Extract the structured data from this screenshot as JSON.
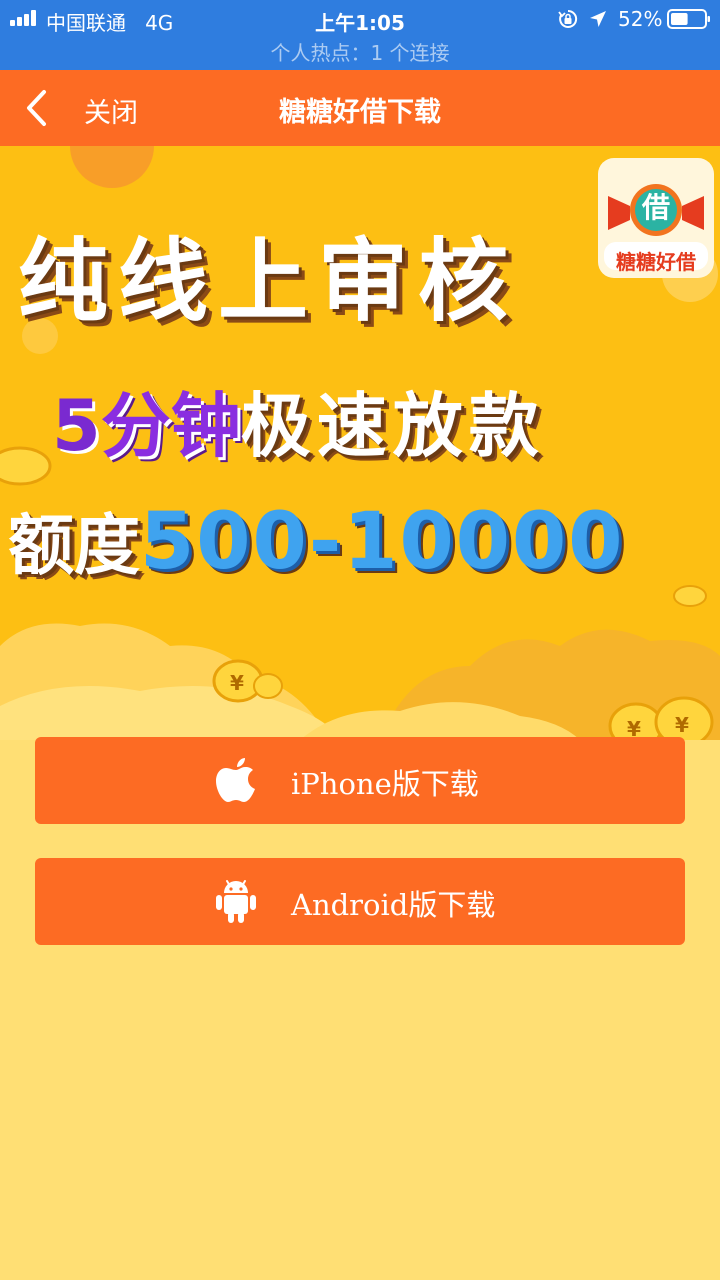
{
  "status_bar": {
    "carrier": "中国联通",
    "network": "4G",
    "time": "上午1:05",
    "battery_percent": "52%",
    "battery_level": 0.52,
    "hotspot": "个人热点：1 个连接"
  },
  "nav": {
    "close_label": "关闭",
    "title": "糖糖好借下载"
  },
  "banner": {
    "logo_char": "借",
    "logo_name": "糖糖好借",
    "headline": "纯线上审核",
    "speed_number": "5",
    "speed_unit": "分钟",
    "speed_text": "极速放款",
    "quota_label": "额度",
    "quota_range": "500-10000"
  },
  "downloads": {
    "iphone_label": "iPhone版下载",
    "android_label": "Android版下载"
  },
  "colors": {
    "status_bar": "#2f7ddf",
    "nav_bar": "#fd6b23",
    "banner_bg": "#fdbf13",
    "page_bg": "#ffdf74",
    "button": "#fd6b23",
    "quota_blue": "#3fa3ef",
    "speed_purple": "#8a2ee0"
  },
  "icons": [
    "signal-icon",
    "orientation-lock-icon",
    "location-arrow-icon",
    "battery-icon",
    "back-chevron-icon",
    "apple-icon",
    "android-icon"
  ]
}
